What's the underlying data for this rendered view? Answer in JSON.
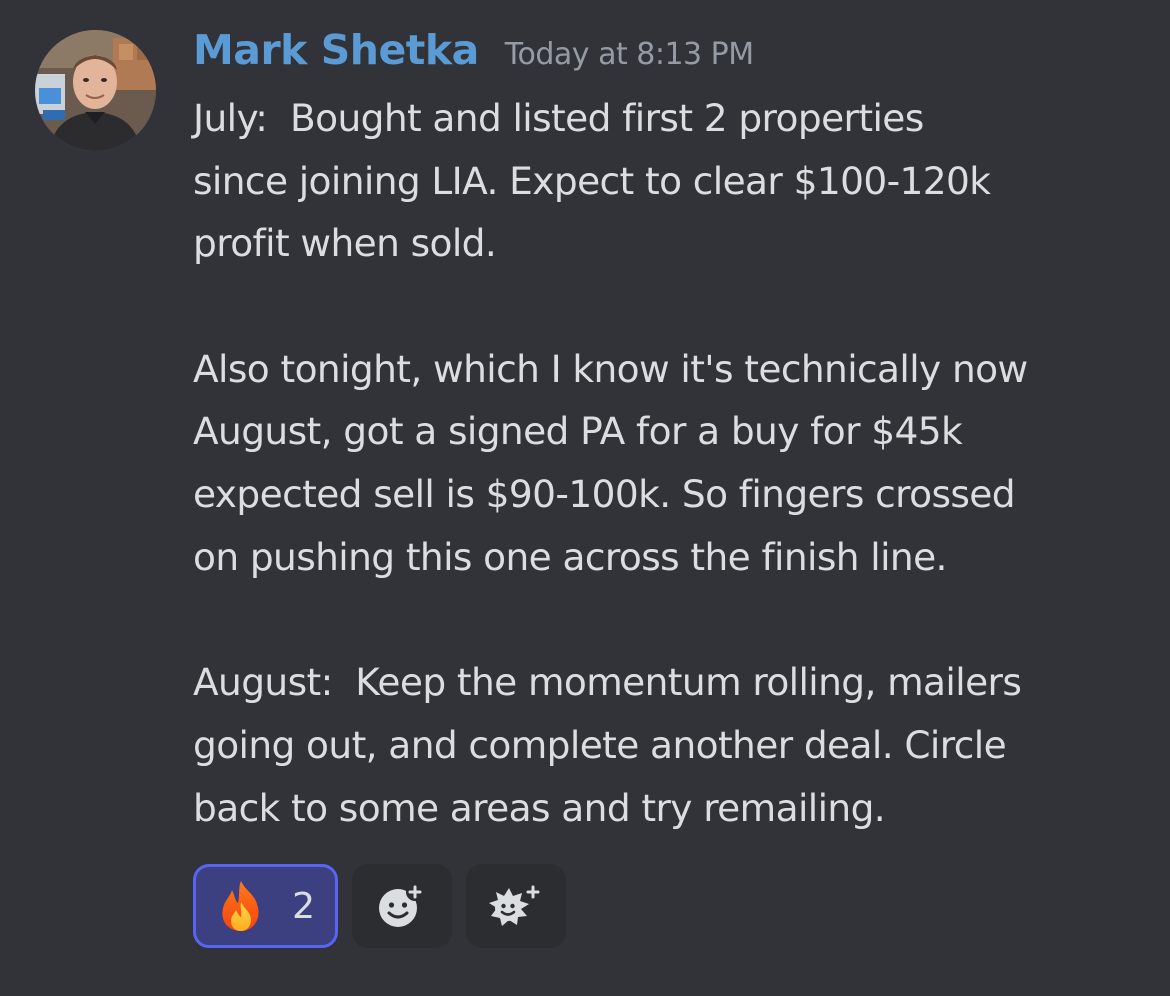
{
  "message": {
    "author": "Mark Shetka",
    "timestamp": "Today at 8:13 PM",
    "lines": [
      "July:  Bought and listed first 2 properties",
      "since joining LIA. Expect to clear $100-120k",
      "profit when sold.",
      "",
      "Also tonight, which I know it's technically now",
      "August, got a signed PA for a buy for $45k",
      "expected sell is $90-100k. So fingers crossed",
      "on pushing this one across the finish line.",
      "",
      "August:  Keep the momentum rolling, mailers",
      "going out, and complete another deal. Circle",
      "back to some areas and try remailing."
    ],
    "reactions": [
      {
        "emoji": "fire-emoji",
        "count": "2",
        "active": true
      }
    ],
    "add_reaction_icon": "add-reaction-icon",
    "add_super_reaction_icon": "add-super-reaction-icon"
  },
  "colors": {
    "background": "#313338",
    "username": "#5b9bd5",
    "timestamp": "#949ba4",
    "text": "#dbdee1",
    "reaction_active_bg": "#3c4080",
    "reaction_active_border": "#5865f2"
  }
}
